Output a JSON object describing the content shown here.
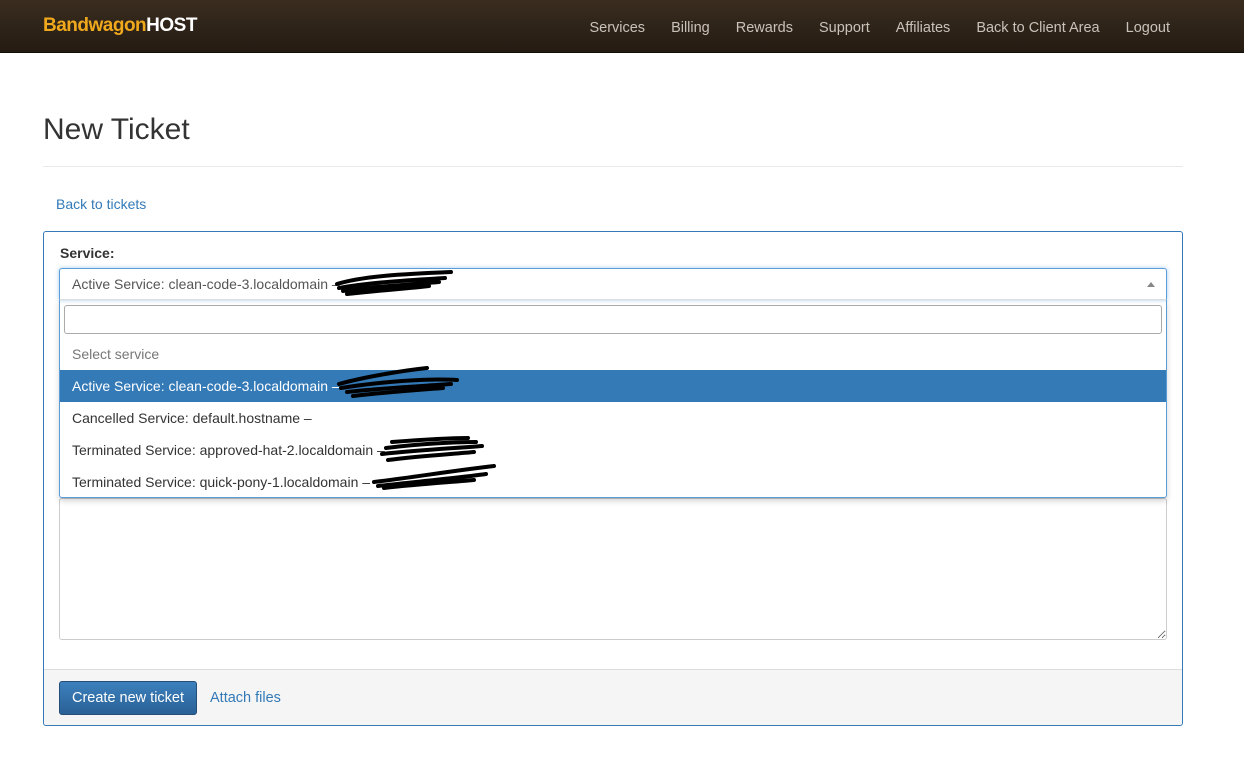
{
  "brand": {
    "part1": "Bandwagon",
    "part2": "HOST"
  },
  "nav": [
    "Services",
    "Billing",
    "Rewards",
    "Support",
    "Affiliates",
    "Back to Client Area",
    "Logout"
  ],
  "page": {
    "title": "New Ticket",
    "back_link": "Back to tickets"
  },
  "form": {
    "service_label": "Service:",
    "selected_value": "Active Service: clean-code-3.localdomain –",
    "search_value": "",
    "options": [
      "Select service",
      "Active Service: clean-code-3.localdomain –",
      "Cancelled Service: default.hostname –",
      "Terminated Service: approved-hat-2.localdomain –",
      "Terminated Service: quick-pony-1.localdomain –"
    ],
    "create_button": "Create new ticket",
    "attach_link": "Attach files"
  },
  "colors": {
    "accent": "#337ab7",
    "navbar": "#2e2318",
    "brand_orange": "#f0a81c"
  }
}
